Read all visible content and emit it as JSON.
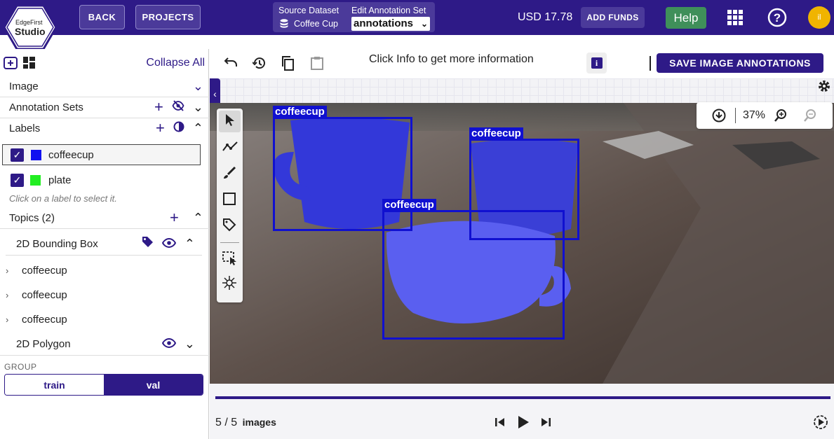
{
  "header": {
    "logo_top": "EdgeFirst",
    "logo_bottom": "Studio",
    "back_label": "BACK",
    "projects_label": "PROJECTS",
    "source_dataset_label": "Source Dataset",
    "source_dataset_value": "Coffee Cup",
    "edit_annotation_label": "Edit Annotation Set",
    "edit_annotation_value": "annotations",
    "balance": "USD 17.78",
    "add_funds_label": "ADD FUNDS",
    "help_label": "Help",
    "avatar_initial": "il"
  },
  "sidebar": {
    "collapse_all": "Collapse All",
    "sections": {
      "image": "Image",
      "annotation_sets": "Annotation Sets",
      "labels": "Labels",
      "topics": "Topics (2)"
    },
    "labels": [
      {
        "name": "coffeecup",
        "color": "#1010f0",
        "selected": true
      },
      {
        "name": "plate",
        "color": "#22ee22",
        "selected": false
      }
    ],
    "hint": "Click on a label to select it.",
    "topics": {
      "bbox_title": "2D Bounding Box",
      "items": [
        "coffeecup",
        "coffeecup",
        "coffeecup"
      ],
      "polygon_title": "2D Polygon"
    },
    "group": {
      "label": "GROUP",
      "options": [
        "train",
        "val"
      ],
      "selected": "val"
    }
  },
  "toolbar": {
    "info_text": "Click Info to get more information",
    "save_label": "SAVE IMAGE ANNOTATIONS"
  },
  "canvas": {
    "zoom": "37%",
    "annotations": [
      {
        "label": "coffeecup"
      },
      {
        "label": "coffeecup"
      },
      {
        "label": "coffeecup"
      }
    ]
  },
  "footer": {
    "current": "5",
    "separator": "/",
    "total": "5",
    "unit": "images",
    "progress": 1.0
  },
  "colors": {
    "brand": "#2e1a87",
    "help": "#3f8f5a",
    "box": "#1010d0"
  }
}
